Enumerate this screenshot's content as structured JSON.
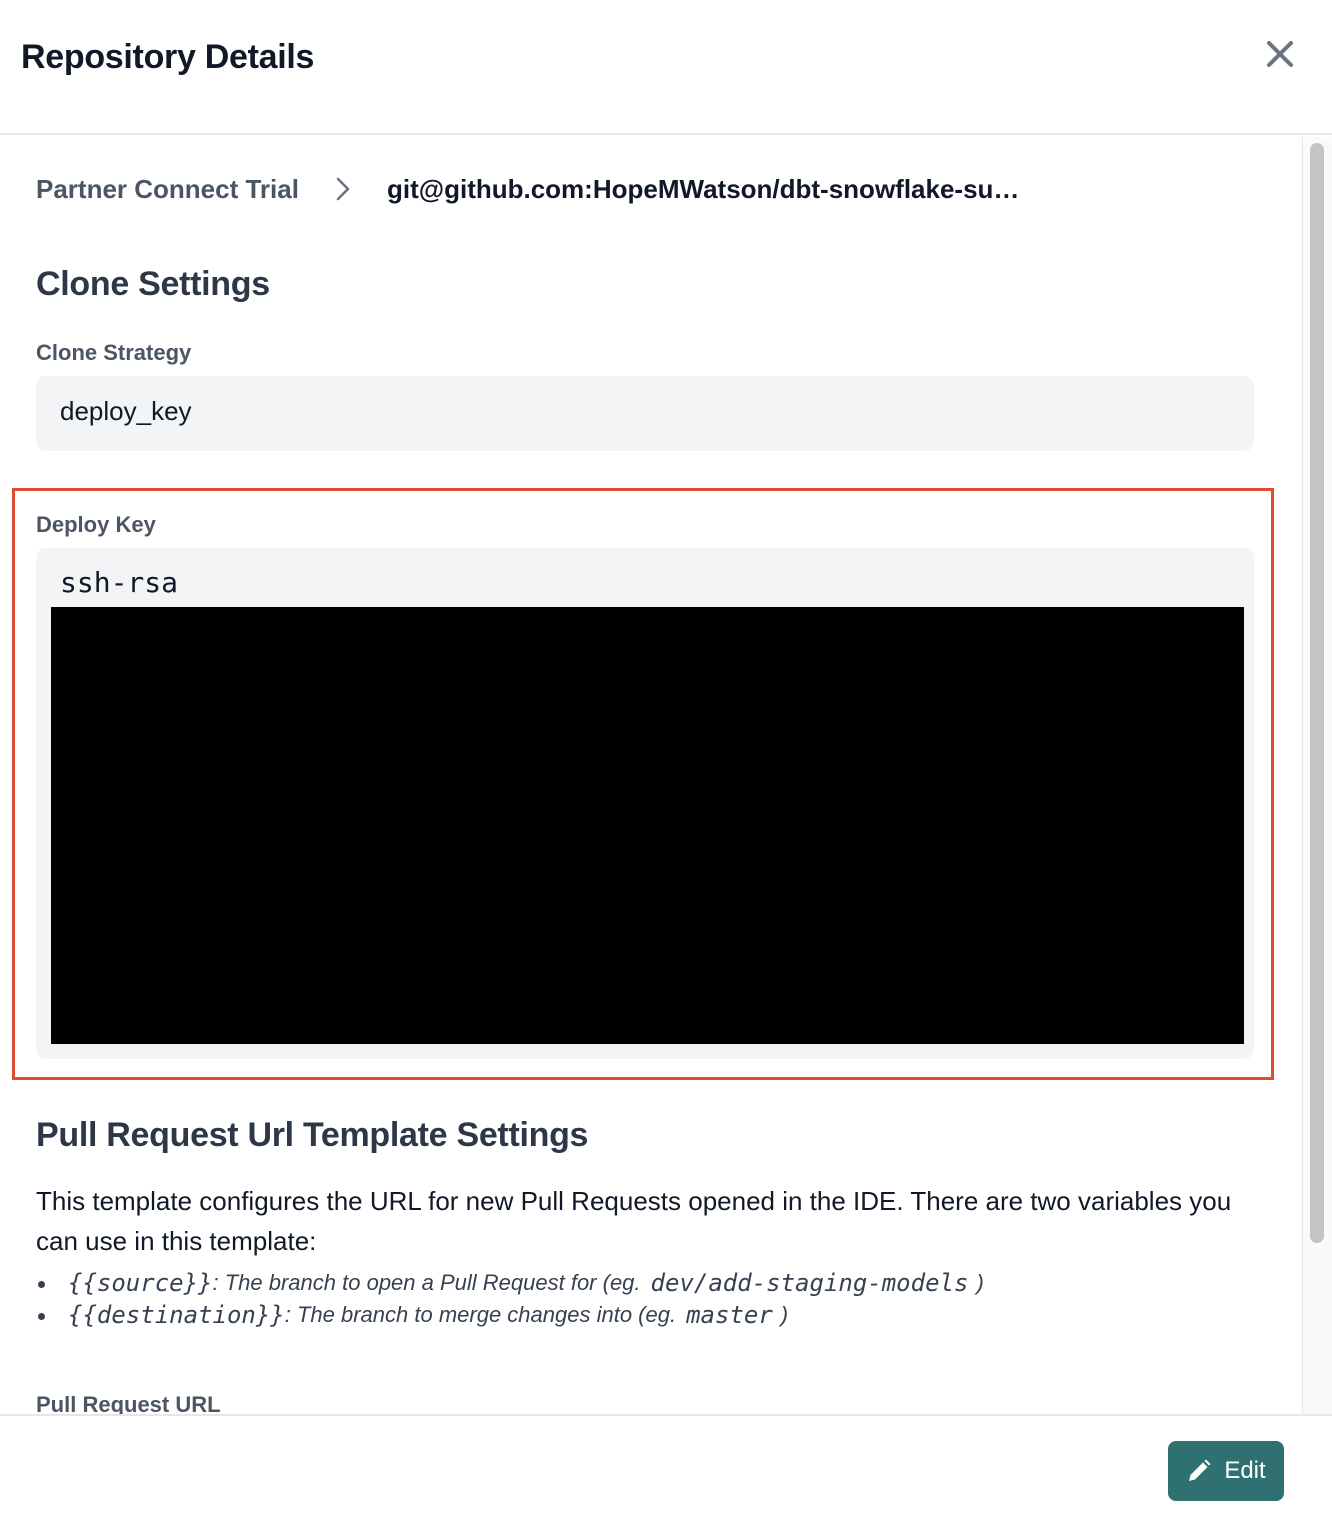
{
  "dialog": {
    "title": "Repository Details",
    "close_icon": "close-icon"
  },
  "breadcrumb": {
    "items": [
      "Partner Connect Trial",
      "git@github.com:HopeMWatson/dbt-snowflake-su…"
    ],
    "separator_icon": "chevron-right-icon"
  },
  "clone_settings": {
    "heading": "Clone Settings",
    "strategy_label": "Clone Strategy",
    "strategy_value": "deploy_key",
    "deploy_key_label": "Deploy Key",
    "deploy_key_value": "ssh-rsa",
    "highlight_color": "#e14b32",
    "redaction_color": "#000000"
  },
  "pr_settings": {
    "heading": "Pull Request Url Template Settings",
    "description": "This template configures the URL for new Pull Requests opened in the IDE. There are two variables you can use in this template:",
    "variables": [
      {
        "name": "{{source}}",
        "text": ": The branch to open a Pull Request for (eg.",
        "example": "dev/add-staging-models",
        "close": ")"
      },
      {
        "name": "{{destination}}",
        "text": ": The branch to merge changes into (eg.",
        "example": "master",
        "close": ")"
      }
    ],
    "url_label": "Pull Request URL"
  },
  "footer": {
    "edit_label": "Edit",
    "edit_icon": "pencil-icon",
    "accent": "#2e7170"
  }
}
